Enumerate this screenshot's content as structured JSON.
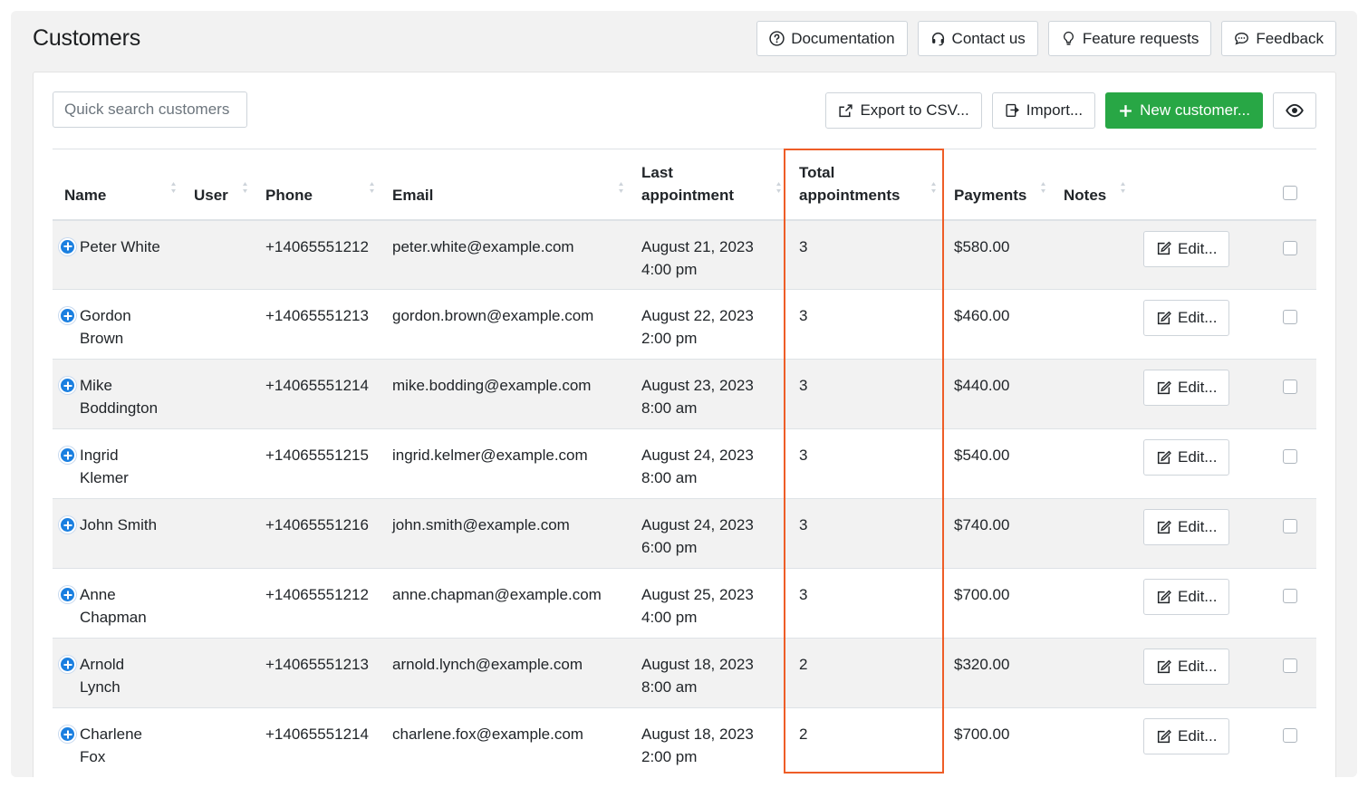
{
  "page": {
    "title": "Customers"
  },
  "top_actions": [
    {
      "label": "Documentation",
      "icon": "question-circle-icon"
    },
    {
      "label": "Contact us",
      "icon": "headset-icon"
    },
    {
      "label": "Feature requests",
      "icon": "lightbulb-icon"
    },
    {
      "label": "Feedback",
      "icon": "chat-icon"
    }
  ],
  "search": {
    "placeholder": "Quick search customers"
  },
  "toolbar": {
    "export_label": "Export to CSV...",
    "import_label": "Import...",
    "new_label": "New customer...",
    "view_icon": "eye-icon",
    "primary_color": "#28a745"
  },
  "table": {
    "headers": {
      "name": "Name",
      "user": "User",
      "phone": "Phone",
      "email": "Email",
      "last_appointment_1": "Last",
      "last_appointment_2": "appointment",
      "total_appointments_1": "Total",
      "total_appointments_2": "appointments",
      "payments": "Payments",
      "notes": "Notes"
    },
    "edit_label": "Edit...",
    "rows": [
      {
        "name1": "Peter White",
        "name2": "",
        "user": "",
        "phone": "+14065551212",
        "email": "peter.white@example.com",
        "date": "August 21, 2023",
        "time": "4:00 pm",
        "total": "3",
        "payments": "$580.00",
        "notes": ""
      },
      {
        "name1": "Gordon",
        "name2": "Brown",
        "user": "",
        "phone": "+14065551213",
        "email": "gordon.brown@example.com",
        "date": "August 22, 2023",
        "time": "2:00 pm",
        "total": "3",
        "payments": "$460.00",
        "notes": ""
      },
      {
        "name1": "Mike",
        "name2": "Boddington",
        "user": "",
        "phone": "+14065551214",
        "email": "mike.bodding@example.com",
        "date": "August 23, 2023",
        "time": "8:00 am",
        "total": "3",
        "payments": "$440.00",
        "notes": ""
      },
      {
        "name1": "Ingrid",
        "name2": "Klemer",
        "user": "",
        "phone": "+14065551215",
        "email": "ingrid.kelmer@example.com",
        "date": "August 24, 2023",
        "time": "8:00 am",
        "total": "3",
        "payments": "$540.00",
        "notes": ""
      },
      {
        "name1": "John Smith",
        "name2": "",
        "user": "",
        "phone": "+14065551216",
        "email": "john.smith@example.com",
        "date": "August 24, 2023",
        "time": "6:00 pm",
        "total": "3",
        "payments": "$740.00",
        "notes": ""
      },
      {
        "name1": "Anne",
        "name2": "Chapman",
        "user": "",
        "phone": "+14065551212",
        "email": "anne.chapman@example.com",
        "date": "August 25, 2023",
        "time": "4:00 pm",
        "total": "3",
        "payments": "$700.00",
        "notes": ""
      },
      {
        "name1": "Arnold",
        "name2": "Lynch",
        "user": "",
        "phone": "+14065551213",
        "email": "arnold.lynch@example.com",
        "date": "August 18, 2023",
        "time": "8:00 am",
        "total": "2",
        "payments": "$320.00",
        "notes": ""
      },
      {
        "name1": "Charlene",
        "name2": "Fox",
        "user": "",
        "phone": "+14065551214",
        "email": "charlene.fox@example.com",
        "date": "August 18, 2023",
        "time": "2:00 pm",
        "total": "2",
        "payments": "$700.00",
        "notes": ""
      }
    ]
  },
  "highlight": {
    "column": "total_appointments",
    "color": "#ee5d27"
  }
}
